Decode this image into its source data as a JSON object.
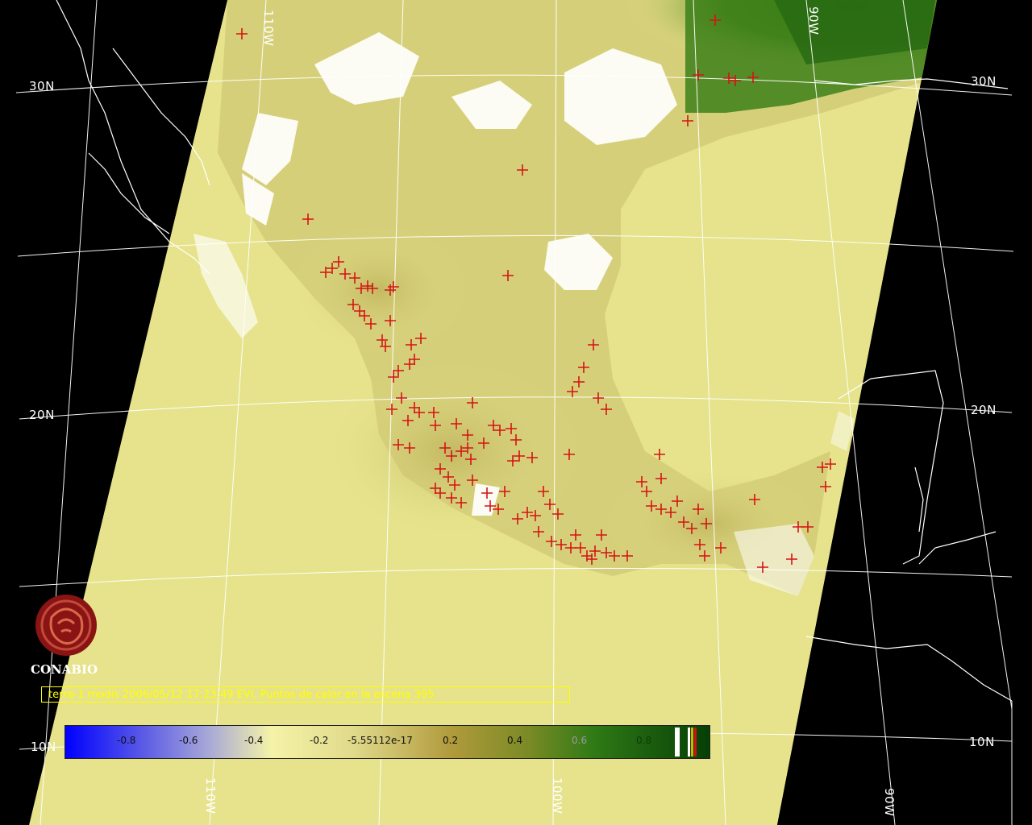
{
  "map": {
    "caption": "terra-1 modis 2006/05/12 17:23:49 EVI, Puntos de calor en la escena 395",
    "lat_labels": [
      "30N",
      "20N",
      "10N"
    ],
    "lon_labels": [
      "110W",
      "100W",
      "90W"
    ],
    "colors": {
      "background": "#000000",
      "swath_base": "#e6e38c",
      "vegetation_high": "#2f7a16",
      "cloud": "#ffffff",
      "hotspot": "#d41414",
      "grid": "#ffffff",
      "coast": "#ffffff"
    },
    "hotspot_marker": "red-plus-icon"
  },
  "colorbar": {
    "ticks": [
      "-0.8",
      "-0.6",
      "-0.4",
      "-0.2",
      "-5.55112e-17",
      "0.2",
      "0.4",
      "0.6",
      "0.8"
    ],
    "colors": [
      "#0000ff",
      "#8a8ad6",
      "#f5f3a8",
      "#e6e38c",
      "#b7a444",
      "#9c8c2c",
      "#3a8a1e",
      "#106b10",
      "#063f06"
    ]
  },
  "logo": {
    "text": "CONABIO",
    "icon": "conabio-seal-icon"
  }
}
